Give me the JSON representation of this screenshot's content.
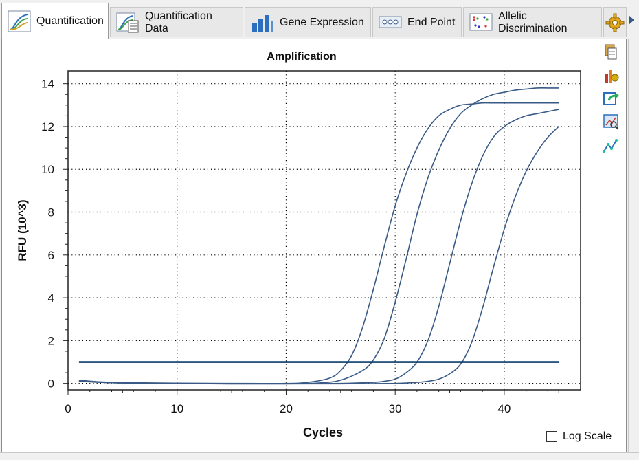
{
  "tabs": [
    {
      "label": "Quantification",
      "icon": "amplification-curve-icon",
      "active": true
    },
    {
      "label": "Quantification Data",
      "icon": "quantification-data-icon",
      "active": false
    },
    {
      "label": "Gene Expression",
      "icon": "bar-chart-icon",
      "active": false
    },
    {
      "label": "End Point",
      "icon": "plate-wells-icon",
      "active": false
    },
    {
      "label": "Allelic Discrimination",
      "icon": "scatter-dots-icon",
      "active": false
    }
  ],
  "settings_icon": "gear-icon",
  "side_tools": [
    "copy-icon",
    "chart-settings-icon",
    "export-icon",
    "zoom-icon",
    "trace-styles-icon"
  ],
  "log_scale": {
    "label": "Log Scale",
    "checked": false
  },
  "colors": {
    "curve": "#3a5a86",
    "threshold": "#0a3d6b",
    "grid": "#000000"
  },
  "chart_data": {
    "type": "line",
    "title": "Amplification",
    "xlabel": "Cycles",
    "ylabel": "RFU (10^3)",
    "xlim": [
      0,
      47
    ],
    "ylim": [
      -0.3,
      14.6
    ],
    "xticks": [
      0,
      10,
      20,
      30,
      40
    ],
    "yticks": [
      0,
      2,
      4,
      6,
      8,
      10,
      12,
      14
    ],
    "grid": true,
    "threshold": {
      "x": [
        1,
        45
      ],
      "y": 1.0
    },
    "series": [
      {
        "x": [
          1,
          3,
          5,
          10,
          15,
          20,
          22,
          24,
          25,
          26,
          27,
          28,
          29,
          30,
          31,
          32,
          33,
          34,
          35,
          36,
          37,
          38,
          39,
          40,
          41,
          42,
          43,
          44,
          45
        ],
        "y": [
          0.15,
          0.07,
          0.04,
          0.01,
          0.0,
          0.0,
          0.05,
          0.25,
          0.6,
          1.3,
          2.6,
          4.4,
          6.4,
          8.3,
          9.8,
          11.0,
          11.9,
          12.5,
          12.8,
          13.0,
          13.05,
          13.1,
          13.1,
          13.1,
          13.1,
          13.1,
          13.1,
          13.1,
          13.1
        ]
      },
      {
        "x": [
          1,
          3,
          5,
          10,
          15,
          20,
          23,
          25,
          27,
          28,
          29,
          30,
          31,
          32,
          33,
          34,
          35,
          36,
          37,
          38,
          39,
          40,
          41,
          42,
          43,
          44,
          45
        ],
        "y": [
          0.12,
          0.06,
          0.03,
          0.0,
          -0.02,
          -0.02,
          0.02,
          0.15,
          0.6,
          1.1,
          2.1,
          3.8,
          5.8,
          7.9,
          9.6,
          10.9,
          11.9,
          12.6,
          13.0,
          13.3,
          13.5,
          13.6,
          13.7,
          13.75,
          13.8,
          13.8,
          13.8
        ]
      },
      {
        "x": [
          1,
          3,
          5,
          10,
          15,
          20,
          25,
          28,
          29,
          30,
          31,
          32,
          33,
          34,
          35,
          36,
          37,
          38,
          39,
          40,
          41,
          42,
          43,
          44,
          45
        ],
        "y": [
          0.1,
          0.05,
          0.02,
          -0.01,
          -0.02,
          -0.02,
          0.0,
          0.05,
          0.1,
          0.2,
          0.5,
          1.0,
          2.0,
          3.6,
          5.6,
          7.6,
          9.3,
          10.6,
          11.5,
          12.0,
          12.3,
          12.5,
          12.6,
          12.7,
          12.8
        ]
      },
      {
        "x": [
          1,
          3,
          5,
          10,
          15,
          20,
          25,
          30,
          32,
          33,
          34,
          35,
          36,
          37,
          38,
          39,
          40,
          41,
          42,
          43,
          44,
          45
        ],
        "y": [
          0.1,
          0.05,
          0.02,
          -0.01,
          -0.02,
          -0.02,
          -0.02,
          0.0,
          0.05,
          0.1,
          0.2,
          0.45,
          0.9,
          1.9,
          3.5,
          5.4,
          7.2,
          8.7,
          9.9,
          10.8,
          11.5,
          12.0
        ]
      }
    ]
  }
}
